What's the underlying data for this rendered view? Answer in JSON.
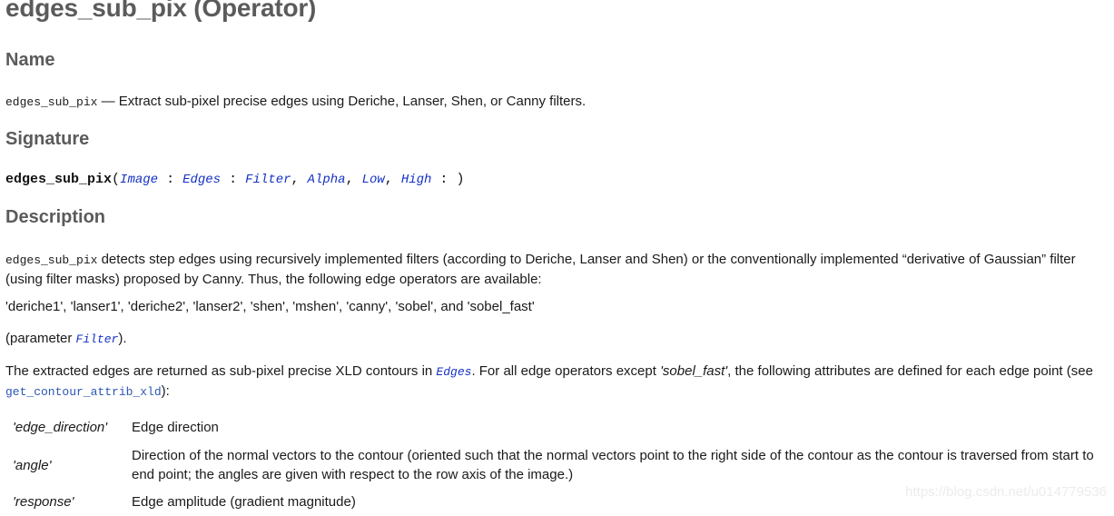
{
  "document": {
    "title": "edges_sub_pix (Operator)"
  },
  "sections": {
    "name": {
      "heading": "Name",
      "operator": "edges_sub_pix",
      "dash": "—",
      "summary": "Extract sub-pixel precise edges using Deriche, Lanser, Shen, or Canny filters."
    },
    "signature": {
      "heading": "Signature",
      "operator": "edges_sub_pix",
      "open_paren": "(",
      "params": [
        {
          "text": "Image",
          "sep": " : "
        },
        {
          "text": "Edges",
          "sep": " : "
        },
        {
          "text": "Filter",
          "sep": ", "
        },
        {
          "text": "Alpha",
          "sep": ", "
        },
        {
          "text": "Low",
          "sep": ", "
        },
        {
          "text": "High",
          "sep": " : "
        }
      ],
      "close_paren": ")",
      "full": "edges_sub_pix(Image : Edges : Filter, Alpha, Low, High : )"
    },
    "description": {
      "heading": "Description",
      "operator": "edges_sub_pix",
      "paragraph_1": " detects step edges using recursively implemented filters (according to Deriche, Lanser and Shen) or the conventionally implemented “derivative of Gaussian” filter (using filter masks) proposed by Canny. Thus, the following edge operators are available:",
      "filter_list": "'deriche1', 'lanser1', 'deriche2', 'lanser2', 'shen', 'mshen', 'canny', 'sobel', and 'sobel_fast'",
      "param_note_prefix": "(parameter ",
      "param_note_param": "Filter",
      "param_note_suffix": ").",
      "extracted_1": "The extracted edges are returned as sub-pixel precise XLD contours in ",
      "extracted_param": "Edges",
      "extracted_2": ". For all edge operators except ",
      "extracted_italic": "'sobel_fast'",
      "extracted_3": ", the following attributes are defined for each edge point (see ",
      "extracted_link": "get_contour_attrib_xld",
      "extracted_4": "):"
    }
  },
  "attributes": [
    {
      "key": "'edge_direction'",
      "value": "Edge direction"
    },
    {
      "key": "'angle'",
      "value": "Direction of the normal vectors to the contour (oriented such that the normal vectors point to the right side of the contour as the contour is traversed from start to end point; the angles are given with respect to the row axis of the image.)"
    },
    {
      "key": "'response'",
      "value": "Edge amplitude (gradient magnitude)"
    }
  ],
  "watermark": {
    "text": "https://blog.csdn.net/u014779536"
  },
  "colors": {
    "heading": "#5b5b5b",
    "body": "#1a1a1a",
    "param_blue": "#1431c4",
    "link_blue": "#2b57b5",
    "watermark": "#ececec",
    "background": "#ffffff"
  }
}
